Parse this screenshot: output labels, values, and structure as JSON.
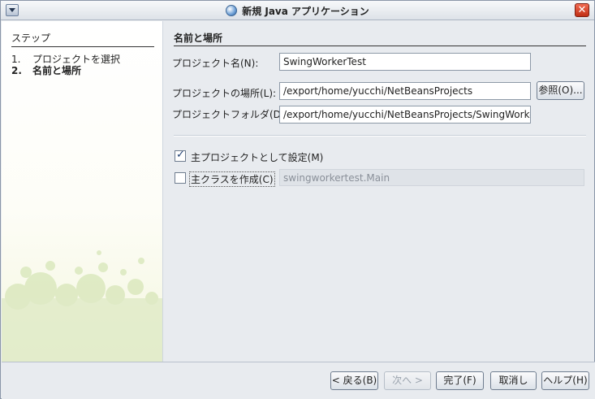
{
  "window": {
    "title": "新規 Java アプリケーション"
  },
  "steps": {
    "title": "ステップ",
    "items": [
      {
        "num": "1.",
        "label": "プロジェクトを選択",
        "active": false
      },
      {
        "num": "2.",
        "label": "名前と場所",
        "active": true
      }
    ]
  },
  "form": {
    "section_title": "名前と場所",
    "project_name_label": "プロジェクト名(N):",
    "project_name_value": "SwingWorkerTest",
    "project_location_label": "プロジェクトの場所(L):",
    "project_location_value": "/export/home/yucchi/NetBeansProjects",
    "browse_label": "参照(O)...",
    "project_folder_label": "プロジェクトフォルダ(D):",
    "project_folder_value": "/export/home/yucchi/NetBeansProjects/SwingWorkerTest",
    "set_main_project_label": "主プロジェクトとして設定(M)",
    "set_main_project_checked": true,
    "create_main_class_label": "主クラスを作成(C)",
    "create_main_class_checked": false,
    "main_class_value": "swingworkertest.Main"
  },
  "buttons": {
    "back": "< 戻る(B)",
    "next": "次へ >",
    "finish": "完了(F)",
    "cancel": "取消し",
    "help": "ヘルプ(H)"
  },
  "colors": {
    "panel_bg": "#e8ebef",
    "close_button": "#d9442b"
  }
}
